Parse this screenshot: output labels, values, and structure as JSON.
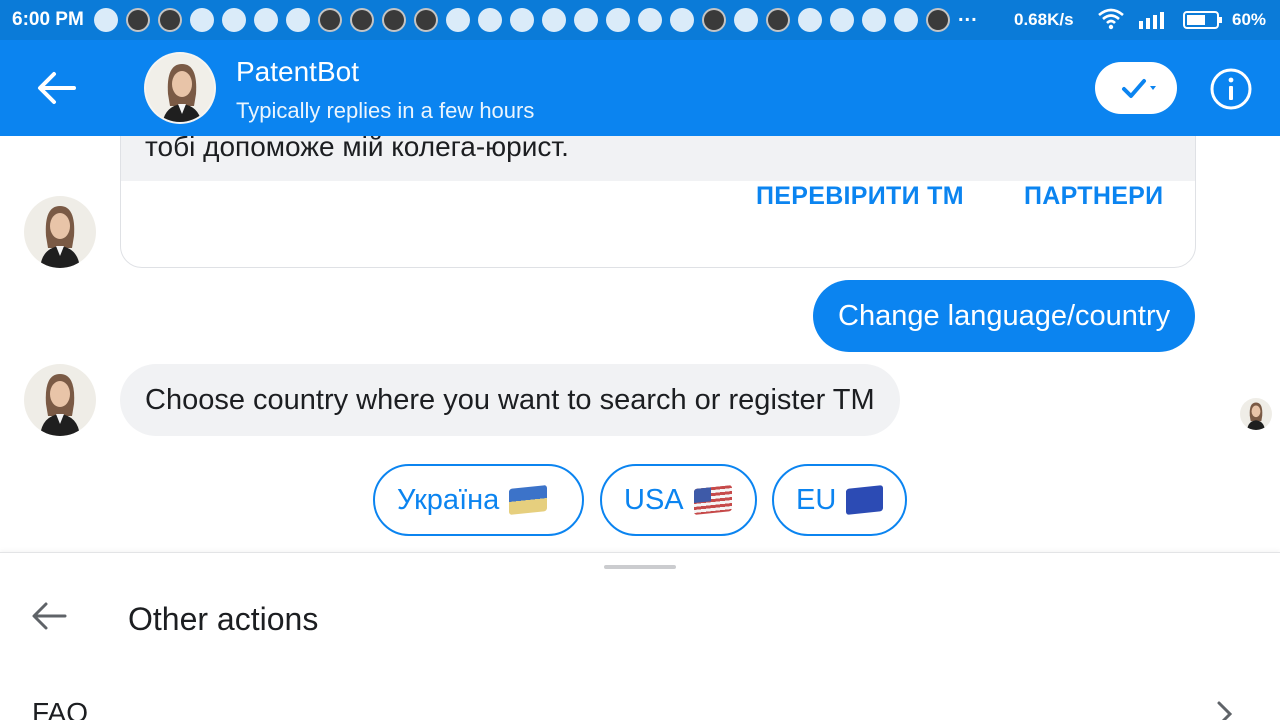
{
  "status_bar": {
    "time": "6:00 PM",
    "more": "...",
    "net_speed": "0.68K/s",
    "battery": "60%",
    "notification_icons": [
      "facebook-icon",
      "app-icon",
      "app-icon",
      "telegram-icon",
      "viber-icon",
      "mail-icon",
      "maps-icon",
      "app-icon",
      "app-icon",
      "app-icon",
      "app-icon",
      "messenger-icon",
      "mail-icon",
      "messenger-icon",
      "cloud-icon",
      "maps-icon",
      "messenger-icon",
      "pinterest-icon",
      "chat-icon",
      "app-icon",
      "pinterest-icon",
      "app-icon",
      "messenger-icon",
      "messenger-icon",
      "facebook-icon",
      "messenger-icon",
      "app-icon"
    ]
  },
  "header": {
    "name": "PatentBot",
    "subtitle": "Typically replies in a few hours",
    "accent": "#0b84f0"
  },
  "card": {
    "text": "тобі допоможе мій колега-юрист.",
    "buttons": [
      "ПЕРЕВІРИТИ TM",
      "ПАРТНЕРИ"
    ]
  },
  "messages": {
    "outgoing": "Change language/country",
    "incoming": "Choose country where you want to search or register TM"
  },
  "quick_replies": [
    {
      "label": "Україна",
      "flag": "ukraine-flag-icon"
    },
    {
      "label": "USA",
      "flag": "usa-flag-icon"
    },
    {
      "label": "EU",
      "flag": "eu-flag-icon"
    }
  ],
  "sheet": {
    "title": "Other actions",
    "items": [
      {
        "label": "FAQ"
      }
    ]
  }
}
